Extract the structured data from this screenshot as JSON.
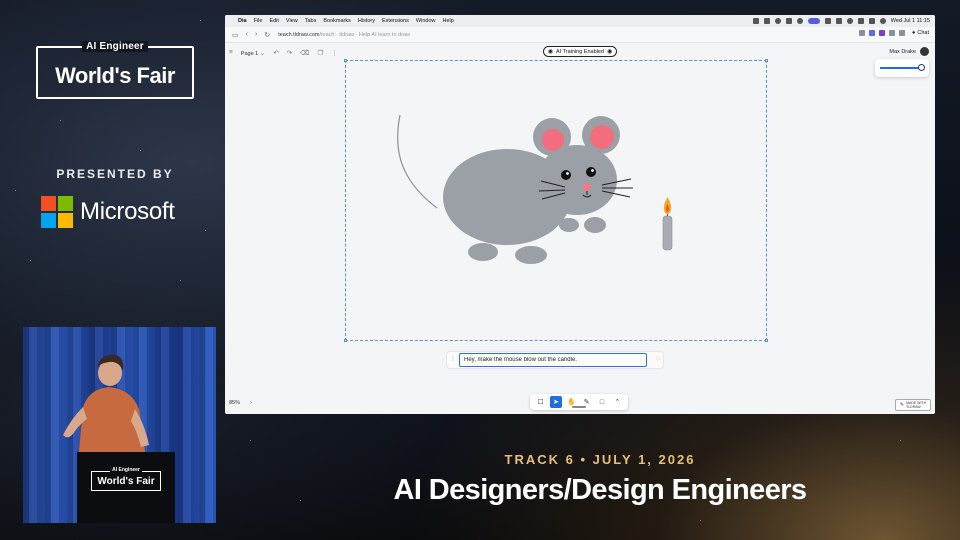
{
  "branding": {
    "event_small": "AI Engineer",
    "event_big": "World's Fair",
    "presented_by": "PRESENTED BY",
    "sponsor": "Microsoft",
    "sponsor_colors": [
      "#f25022",
      "#7fba00",
      "#00a4ef",
      "#ffb900"
    ]
  },
  "podium": {
    "small": "AI Engineer",
    "big": "World's Fair"
  },
  "caption": {
    "track": "TRACK 6 • JULY 1, 2026",
    "title": "AI Designers/Design Engineers"
  },
  "menubar": {
    "app": "Dia",
    "items": [
      "File",
      "Edit",
      "View",
      "Tabs",
      "Bookmarks",
      "History",
      "Extensions",
      "Window",
      "Help"
    ],
    "clock": "Wed Jul 1  11:15"
  },
  "browser": {
    "url_host": "teach.tldraw.com",
    "url_rest": "/teach · tldraw · Help AI learn to draw",
    "chat_label": "Chat"
  },
  "canvas": {
    "page_label": "Page 1",
    "ai_status": "AI Training Enabled",
    "user_name": "Max Drake",
    "prompt_value": "Hey, make the mouse blow out the candle.",
    "zoom": "85%",
    "made_with_line1": "MADE WITH",
    "made_with_line2": "TLDRAW"
  },
  "drawing": {
    "mouse_body_color": "#9aa0a6",
    "ear_inner_color": "#f26d7d",
    "flame_color": "#f5a623",
    "candle_color": "#a9adb3"
  },
  "colors": {
    "accent": "#1e6fd9",
    "track": "#e6c07a"
  }
}
